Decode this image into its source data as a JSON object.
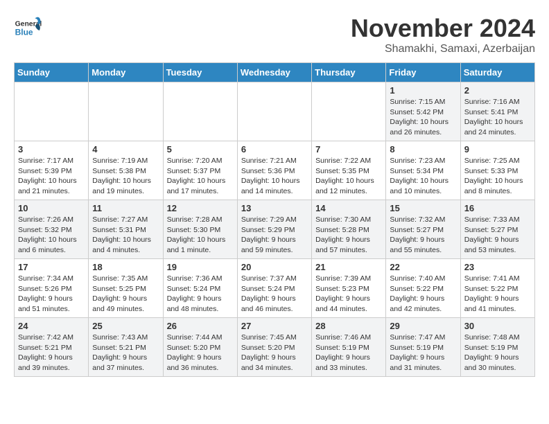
{
  "logo": {
    "text_general": "General",
    "text_blue": "Blue"
  },
  "title": "November 2024",
  "subtitle": "Shamakhi, Samaxi, Azerbaijan",
  "headers": [
    "Sunday",
    "Monday",
    "Tuesday",
    "Wednesday",
    "Thursday",
    "Friday",
    "Saturday"
  ],
  "weeks": [
    [
      {
        "day": "",
        "sunrise": "",
        "sunset": "",
        "daylight": ""
      },
      {
        "day": "",
        "sunrise": "",
        "sunset": "",
        "daylight": ""
      },
      {
        "day": "",
        "sunrise": "",
        "sunset": "",
        "daylight": ""
      },
      {
        "day": "",
        "sunrise": "",
        "sunset": "",
        "daylight": ""
      },
      {
        "day": "",
        "sunrise": "",
        "sunset": "",
        "daylight": ""
      },
      {
        "day": "1",
        "sunrise": "Sunrise: 7:15 AM",
        "sunset": "Sunset: 5:42 PM",
        "daylight": "Daylight: 10 hours and 26 minutes."
      },
      {
        "day": "2",
        "sunrise": "Sunrise: 7:16 AM",
        "sunset": "Sunset: 5:41 PM",
        "daylight": "Daylight: 10 hours and 24 minutes."
      }
    ],
    [
      {
        "day": "3",
        "sunrise": "Sunrise: 7:17 AM",
        "sunset": "Sunset: 5:39 PM",
        "daylight": "Daylight: 10 hours and 21 minutes."
      },
      {
        "day": "4",
        "sunrise": "Sunrise: 7:19 AM",
        "sunset": "Sunset: 5:38 PM",
        "daylight": "Daylight: 10 hours and 19 minutes."
      },
      {
        "day": "5",
        "sunrise": "Sunrise: 7:20 AM",
        "sunset": "Sunset: 5:37 PM",
        "daylight": "Daylight: 10 hours and 17 minutes."
      },
      {
        "day": "6",
        "sunrise": "Sunrise: 7:21 AM",
        "sunset": "Sunset: 5:36 PM",
        "daylight": "Daylight: 10 hours and 14 minutes."
      },
      {
        "day": "7",
        "sunrise": "Sunrise: 7:22 AM",
        "sunset": "Sunset: 5:35 PM",
        "daylight": "Daylight: 10 hours and 12 minutes."
      },
      {
        "day": "8",
        "sunrise": "Sunrise: 7:23 AM",
        "sunset": "Sunset: 5:34 PM",
        "daylight": "Daylight: 10 hours and 10 minutes."
      },
      {
        "day": "9",
        "sunrise": "Sunrise: 7:25 AM",
        "sunset": "Sunset: 5:33 PM",
        "daylight": "Daylight: 10 hours and 8 minutes."
      }
    ],
    [
      {
        "day": "10",
        "sunrise": "Sunrise: 7:26 AM",
        "sunset": "Sunset: 5:32 PM",
        "daylight": "Daylight: 10 hours and 6 minutes."
      },
      {
        "day": "11",
        "sunrise": "Sunrise: 7:27 AM",
        "sunset": "Sunset: 5:31 PM",
        "daylight": "Daylight: 10 hours and 4 minutes."
      },
      {
        "day": "12",
        "sunrise": "Sunrise: 7:28 AM",
        "sunset": "Sunset: 5:30 PM",
        "daylight": "Daylight: 10 hours and 1 minute."
      },
      {
        "day": "13",
        "sunrise": "Sunrise: 7:29 AM",
        "sunset": "Sunset: 5:29 PM",
        "daylight": "Daylight: 9 hours and 59 minutes."
      },
      {
        "day": "14",
        "sunrise": "Sunrise: 7:30 AM",
        "sunset": "Sunset: 5:28 PM",
        "daylight": "Daylight: 9 hours and 57 minutes."
      },
      {
        "day": "15",
        "sunrise": "Sunrise: 7:32 AM",
        "sunset": "Sunset: 5:27 PM",
        "daylight": "Daylight: 9 hours and 55 minutes."
      },
      {
        "day": "16",
        "sunrise": "Sunrise: 7:33 AM",
        "sunset": "Sunset: 5:27 PM",
        "daylight": "Daylight: 9 hours and 53 minutes."
      }
    ],
    [
      {
        "day": "17",
        "sunrise": "Sunrise: 7:34 AM",
        "sunset": "Sunset: 5:26 PM",
        "daylight": "Daylight: 9 hours and 51 minutes."
      },
      {
        "day": "18",
        "sunrise": "Sunrise: 7:35 AM",
        "sunset": "Sunset: 5:25 PM",
        "daylight": "Daylight: 9 hours and 49 minutes."
      },
      {
        "day": "19",
        "sunrise": "Sunrise: 7:36 AM",
        "sunset": "Sunset: 5:24 PM",
        "daylight": "Daylight: 9 hours and 48 minutes."
      },
      {
        "day": "20",
        "sunrise": "Sunrise: 7:37 AM",
        "sunset": "Sunset: 5:24 PM",
        "daylight": "Daylight: 9 hours and 46 minutes."
      },
      {
        "day": "21",
        "sunrise": "Sunrise: 7:39 AM",
        "sunset": "Sunset: 5:23 PM",
        "daylight": "Daylight: 9 hours and 44 minutes."
      },
      {
        "day": "22",
        "sunrise": "Sunrise: 7:40 AM",
        "sunset": "Sunset: 5:22 PM",
        "daylight": "Daylight: 9 hours and 42 minutes."
      },
      {
        "day": "23",
        "sunrise": "Sunrise: 7:41 AM",
        "sunset": "Sunset: 5:22 PM",
        "daylight": "Daylight: 9 hours and 41 minutes."
      }
    ],
    [
      {
        "day": "24",
        "sunrise": "Sunrise: 7:42 AM",
        "sunset": "Sunset: 5:21 PM",
        "daylight": "Daylight: 9 hours and 39 minutes."
      },
      {
        "day": "25",
        "sunrise": "Sunrise: 7:43 AM",
        "sunset": "Sunset: 5:21 PM",
        "daylight": "Daylight: 9 hours and 37 minutes."
      },
      {
        "day": "26",
        "sunrise": "Sunrise: 7:44 AM",
        "sunset": "Sunset: 5:20 PM",
        "daylight": "Daylight: 9 hours and 36 minutes."
      },
      {
        "day": "27",
        "sunrise": "Sunrise: 7:45 AM",
        "sunset": "Sunset: 5:20 PM",
        "daylight": "Daylight: 9 hours and 34 minutes."
      },
      {
        "day": "28",
        "sunrise": "Sunrise: 7:46 AM",
        "sunset": "Sunset: 5:19 PM",
        "daylight": "Daylight: 9 hours and 33 minutes."
      },
      {
        "day": "29",
        "sunrise": "Sunrise: 7:47 AM",
        "sunset": "Sunset: 5:19 PM",
        "daylight": "Daylight: 9 hours and 31 minutes."
      },
      {
        "day": "30",
        "sunrise": "Sunrise: 7:48 AM",
        "sunset": "Sunset: 5:19 PM",
        "daylight": "Daylight: 9 hours and 30 minutes."
      }
    ]
  ]
}
